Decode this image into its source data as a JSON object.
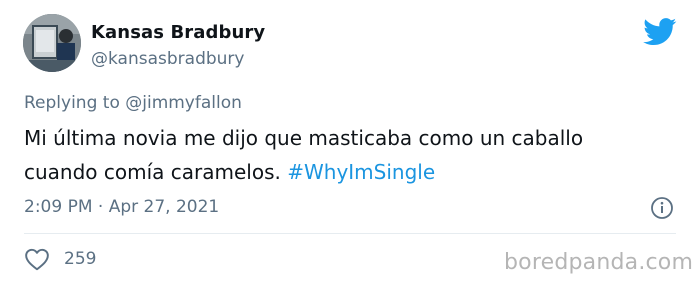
{
  "author": {
    "name": "Kansas Bradbury",
    "handle": "@kansasbradbury"
  },
  "reply": {
    "label": "Replying to @jimmyfallon"
  },
  "tweet": {
    "text": "Mi última novia me dijo que masticaba como un caballo cuando comía caramelos.",
    "hashtag": "#WhyImSingle",
    "timestamp": "2:09 PM · Apr 27, 2021"
  },
  "engagement": {
    "likes": "259"
  },
  "watermark": "boredpanda.com",
  "colors": {
    "accent": "#1b95e0",
    "secondary_text": "#5b7083",
    "primary_text": "#0f1419"
  },
  "icons": {
    "brand": "twitter-bird-icon",
    "info": "info-icon",
    "like": "heart-icon"
  }
}
